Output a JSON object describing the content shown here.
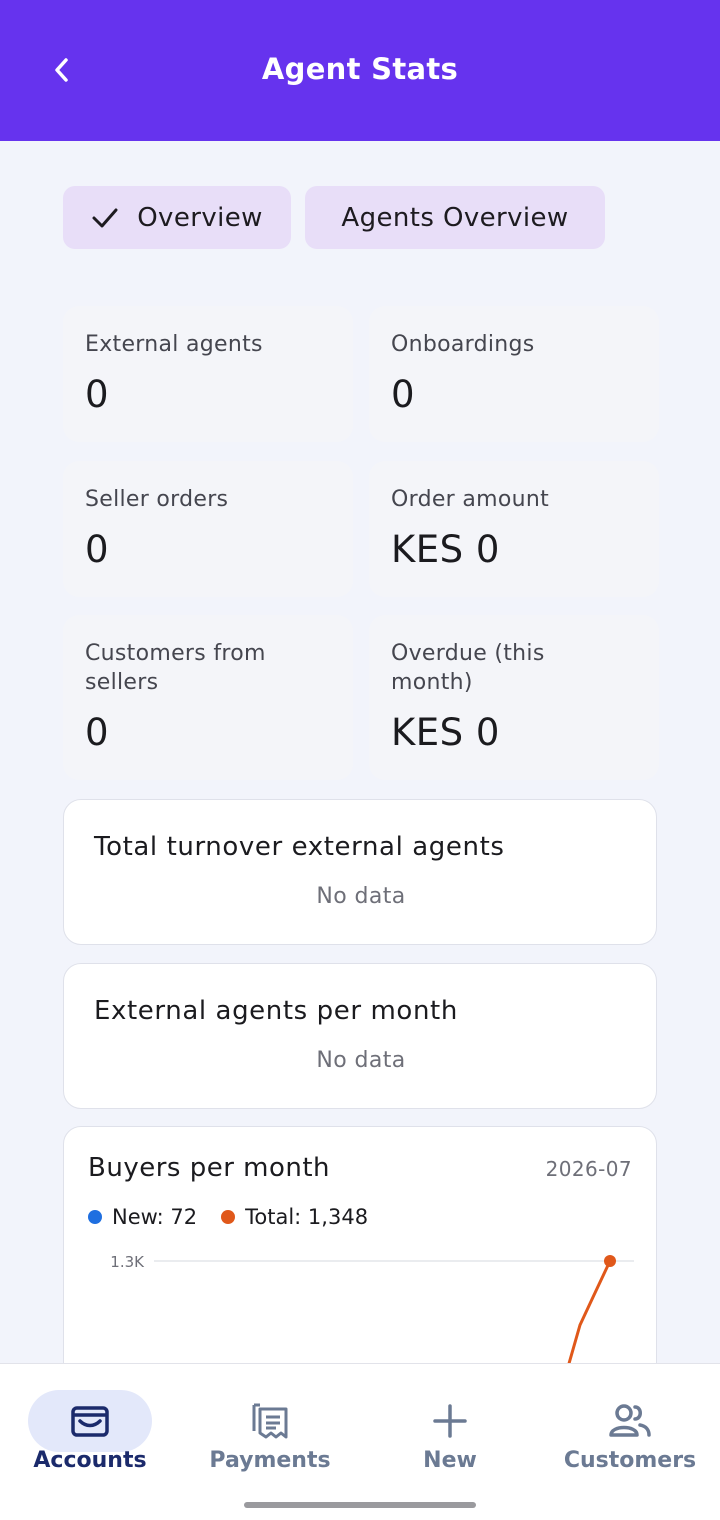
{
  "header": {
    "title": "Agent Stats",
    "back_icon": "chevron-left-icon"
  },
  "tabs": [
    {
      "label": "Overview",
      "selected": true
    },
    {
      "label": "Agents Overview",
      "selected": false
    }
  ],
  "stats": [
    {
      "label": "External agents",
      "value": "0"
    },
    {
      "label": "Onboardings",
      "value": "0"
    },
    {
      "label": "Seller orders",
      "value": "0"
    },
    {
      "label": "Order amount",
      "value": "KES 0"
    },
    {
      "label": "Customers from sellers",
      "value": "0"
    },
    {
      "label": "Overdue (this month)",
      "value": "KES 0"
    }
  ],
  "cards": [
    {
      "title": "Total turnover external agents",
      "empty_text": "No data"
    },
    {
      "title": "External agents per month",
      "empty_text": "No data"
    }
  ],
  "buyers_chart": {
    "title": "Buyers per month",
    "period": "2026-07",
    "legend_new": "New: 72",
    "legend_total": "Total: 1,348",
    "y_tick_label": "1.3K",
    "colors": {
      "new": "#1f6fe0",
      "total": "#e0581a"
    }
  },
  "chart_data": {
    "type": "line",
    "title": "Buyers per month",
    "x": [
      "2026-07"
    ],
    "series": [
      {
        "name": "New",
        "values": [
          72
        ]
      },
      {
        "name": "Total",
        "values": [
          1348
        ]
      }
    ],
    "y_ticks": [
      "1.3K"
    ],
    "legend": "top-left"
  },
  "bottom_nav": [
    {
      "label": "Accounts",
      "icon": "wallet-icon",
      "active": true
    },
    {
      "label": "Payments",
      "icon": "receipt-icon",
      "active": false
    },
    {
      "label": "New",
      "icon": "plus-icon",
      "active": false
    },
    {
      "label": "Customers",
      "icon": "people-icon",
      "active": false
    }
  ],
  "colors": {
    "header_bg": "#6633ee",
    "chip_bg": "#e8def8",
    "nav_active": "#1b2a6b",
    "nav_inactive": "#6b7a93"
  }
}
